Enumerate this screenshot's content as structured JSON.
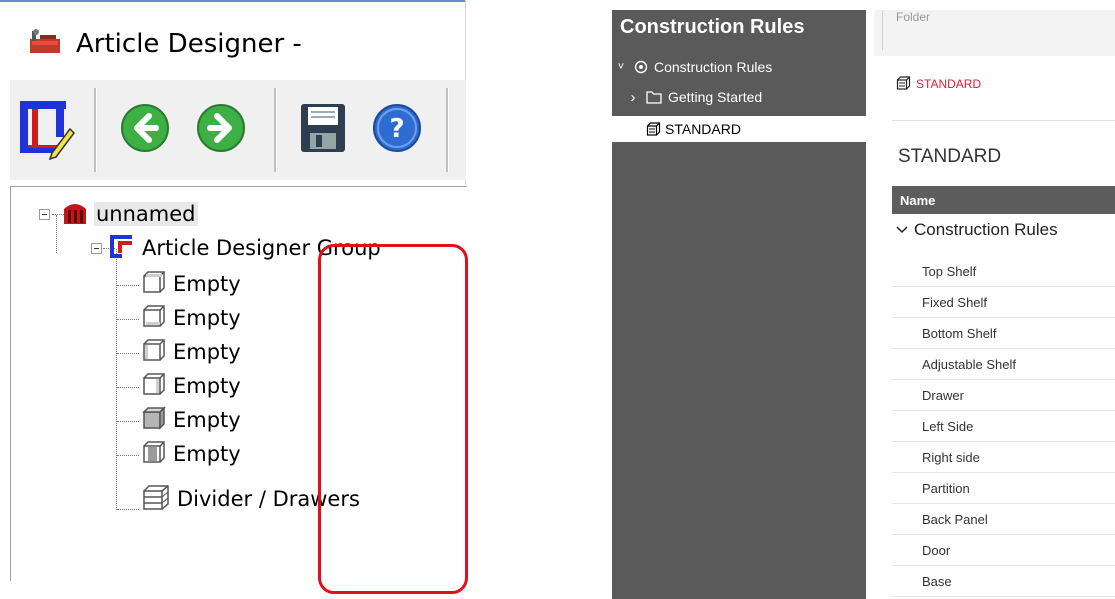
{
  "article_designer": {
    "title": "Article Designer -",
    "toolbar": {
      "items": [
        {
          "name": "design-tool",
          "icon": "frame-pencil-icon"
        },
        {
          "name": "back",
          "icon": "arrow-left-circle-icon"
        },
        {
          "name": "forward",
          "icon": "arrow-right-circle-icon"
        },
        {
          "name": "save",
          "icon": "floppy-disk-icon"
        },
        {
          "name": "help",
          "icon": "question-circle-icon"
        }
      ]
    },
    "tree": {
      "root": "unnamed",
      "group": "Article Designer Group",
      "children": [
        "Empty",
        "Empty",
        "Empty",
        "Empty",
        "Empty",
        "Empty",
        "Divider / Drawers"
      ]
    },
    "colors": {
      "accent_blue": "#5b8fd6",
      "group_red": "#d51c1c",
      "group_blue": "#2033d6"
    }
  },
  "construction_rules": {
    "nav": {
      "title": "Construction Rules",
      "items": [
        {
          "label": "Construction Rules",
          "chevron": "˅",
          "icon": "target-icon"
        },
        {
          "label": "Getting Started",
          "chevron": "›",
          "icon": "folder-icon"
        },
        {
          "label": "STANDARD",
          "chevron": "",
          "icon": "cube-icon",
          "selected": true
        }
      ]
    },
    "content": {
      "folder_label": "Folder",
      "breadcrumb": "STANDARD",
      "title": "STANDARD",
      "table_header": "Name",
      "group": "Construction Rules",
      "rules": [
        "Top Shelf",
        "Fixed Shelf",
        "Bottom Shelf",
        "Adjustable Shelf",
        "Drawer",
        "Left Side",
        "Right side",
        "Partition",
        "Back Panel",
        "Door",
        "Base"
      ]
    },
    "colors": {
      "nav_bg": "#5a5a5a",
      "header_bg": "#5d5d5d",
      "breadcrumb": "#d6203a",
      "highlight": "#e0101b"
    }
  }
}
